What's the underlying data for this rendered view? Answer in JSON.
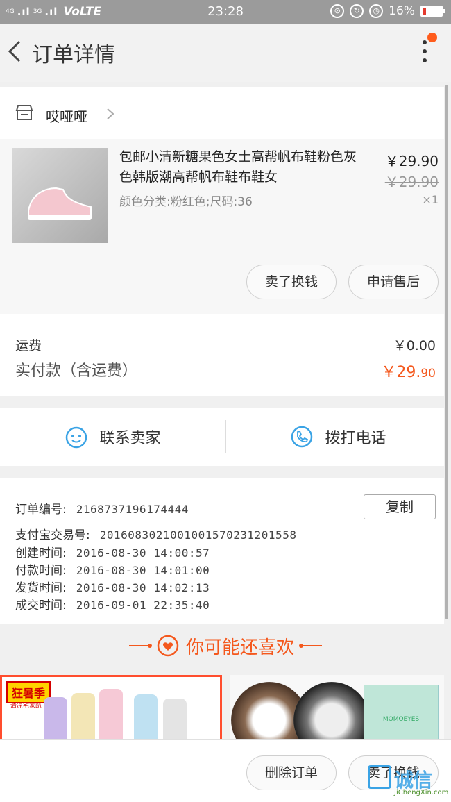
{
  "status_bar": {
    "signal_label": "4G",
    "signal_label2": "3G",
    "network": "VoLTE",
    "time": "23:28",
    "battery": "16%"
  },
  "nav": {
    "title": "订单详情"
  },
  "shop": {
    "name": "哎哑哑"
  },
  "item": {
    "title": "包邮小清新糖果色女士高帮帆布鞋粉色灰色韩版潮高帮帆布鞋布鞋女",
    "sku": "颜色分类:粉红色;尺码:36",
    "price": "￥29.90",
    "original_price": "￥29.90",
    "quantity": "×1",
    "actions": [
      "卖了换钱",
      "申请售后"
    ]
  },
  "fee": {
    "shipping_label": "运费",
    "shipping_value": "￥0.00",
    "total_label": "实付款（含运费）",
    "total_int": "￥29.",
    "total_dec": "90"
  },
  "contact": {
    "seller_label": "联系卖家",
    "call_label": "拨打电话"
  },
  "order_info": {
    "copy_label": "复制",
    "rows": [
      {
        "key": "订单编号:",
        "value": "2168737196174444"
      },
      {
        "key": "支付宝交易号:",
        "value": "2016083021001001570231201558"
      },
      {
        "key": "创建时间:",
        "value": "2016-08-30 14:00:57"
      },
      {
        "key": "付款时间:",
        "value": "2016-08-30 14:01:00"
      },
      {
        "key": "发货时间:",
        "value": "2016-08-30 14:02:13"
      },
      {
        "key": "成交时间:",
        "value": "2016-09-01 22:35:40"
      }
    ]
  },
  "recommend": {
    "title": "你可能还喜欢",
    "promo_tag": "狂暑季",
    "promo_sub": "清凉宅家趴",
    "brand_box": "MOMOEYES"
  },
  "bottom": {
    "delete_label": "删除订单",
    "sell_label": "卖了换钱"
  },
  "watermark": {
    "text": "诚信",
    "sub": "JiChengXin.com"
  },
  "colors": {
    "accent": "#f4581d",
    "blue": "#3aa3e5"
  }
}
